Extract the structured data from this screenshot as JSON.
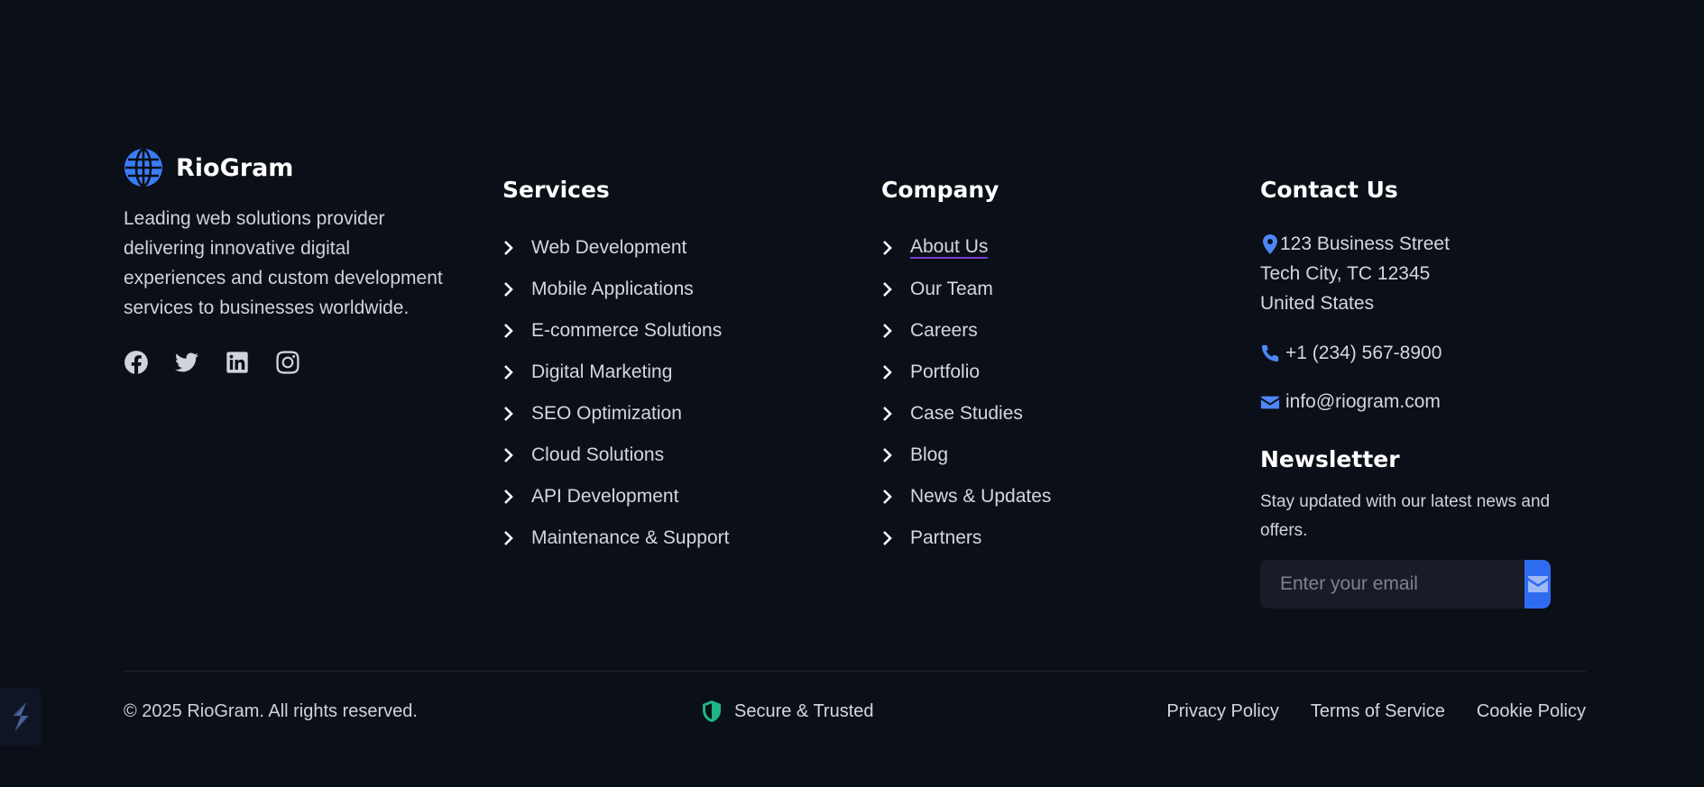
{
  "brand": {
    "name": "RioGram",
    "description": "Leading web solutions provider delivering innovative digital experiences and custom development services to businesses worldwide.",
    "logo_icon": "globe-icon",
    "accent": "#3b7cf6"
  },
  "social": [
    {
      "name": "facebook-icon"
    },
    {
      "name": "twitter-icon"
    },
    {
      "name": "linkedin-icon"
    },
    {
      "name": "instagram-icon"
    }
  ],
  "services": {
    "title": "Services",
    "items": [
      "Web Development",
      "Mobile Applications",
      "E-commerce Solutions",
      "Digital Marketing",
      "SEO Optimization",
      "Cloud Solutions",
      "API Development",
      "Maintenance & Support"
    ]
  },
  "company": {
    "title": "Company",
    "items": [
      "About Us",
      "Our Team",
      "Careers",
      "Portfolio",
      "Case Studies",
      "Blog",
      "News & Updates",
      "Partners"
    ]
  },
  "contact": {
    "title": "Contact Us",
    "address_line1": "123 Business Street",
    "address_line2": "Tech City, TC 12345",
    "address_line3": "United States",
    "phone": "+1 (234) 567-8900",
    "email": "info@riogram.com",
    "icon_color": "#4d86f7"
  },
  "newsletter": {
    "title": "Newsletter",
    "text": "Stay updated with our latest news and offers.",
    "placeholder": "Enter your email",
    "button_icon": "envelope-icon",
    "button_color": "#2f6bf0"
  },
  "bottom": {
    "copyright": "© 2025 RioGram. All rights reserved.",
    "secure": "Secure & Trusted",
    "secure_color": "#1fb486",
    "legal": [
      "Privacy Policy",
      "Terms of Service",
      "Cookie Policy"
    ]
  }
}
